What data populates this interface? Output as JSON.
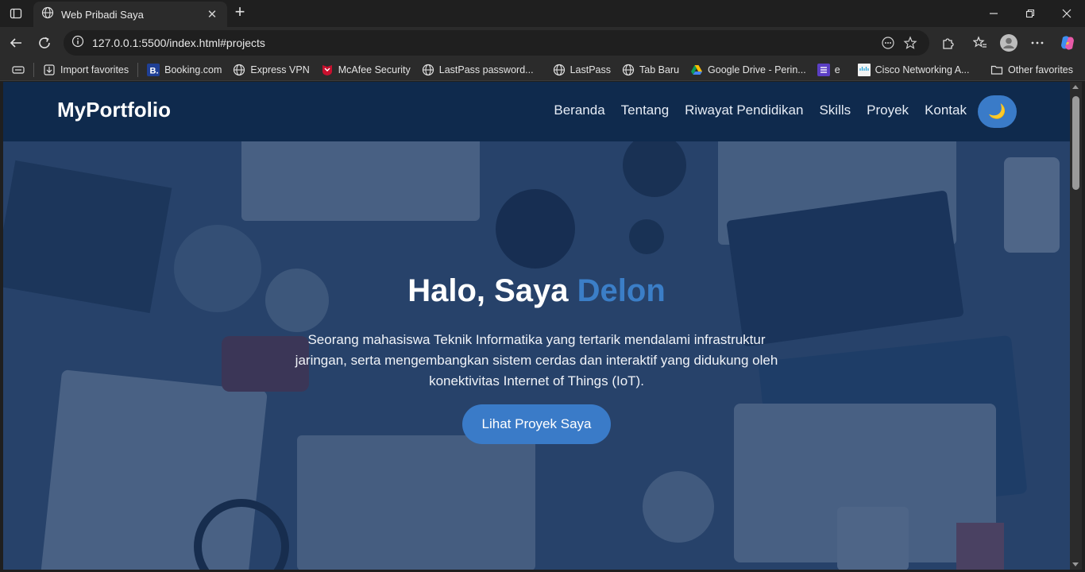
{
  "browser": {
    "tab_title": "Web Pribadi Saya",
    "tab_close": "✕",
    "new_tab": "+",
    "url": "127.0.0.1:5500/index.html#projects",
    "bookmarks": [
      {
        "label": "Import favorites",
        "icon": "import-icon"
      },
      {
        "label": "Booking.com",
        "icon": "booking-icon"
      },
      {
        "label": "Express VPN",
        "icon": "globe-icon"
      },
      {
        "label": "McAfee Security",
        "icon": "mcafee-icon"
      },
      {
        "label": "LastPass password...",
        "icon": "globe-icon"
      },
      {
        "label": "LastPass",
        "icon": "globe-icon"
      },
      {
        "label": "Tab Baru",
        "icon": "globe-icon"
      },
      {
        "label": "Google Drive - Perin...",
        "icon": "google-drive-icon"
      },
      {
        "label": "e",
        "icon": "list-icon"
      },
      {
        "label": "Cisco Networking A...",
        "icon": "cisco-icon"
      }
    ],
    "other_favorites": "Other favorites"
  },
  "site": {
    "logo": "MyPortfolio",
    "nav": [
      "Beranda",
      "Tentang",
      "Riwayat Pendidikan",
      "Skills",
      "Proyek",
      "Kontak"
    ],
    "theme_toggle": "🌙",
    "hero": {
      "title_prefix": "Halo, Saya ",
      "title_name": "Delon",
      "description": "Seorang mahasiswa Teknik Informatika yang tertarik mendalami infrastruktur jaringan, serta mengembangkan sistem cerdas dan interaktif yang didukung oleh konektivitas Internet of Things (IoT).",
      "cta_label": "Lihat Proyek Saya"
    }
  },
  "colors": {
    "header_bg": "#0f2a4d",
    "accent": "#3a7bc8",
    "hero_overlay": "#14325f"
  }
}
